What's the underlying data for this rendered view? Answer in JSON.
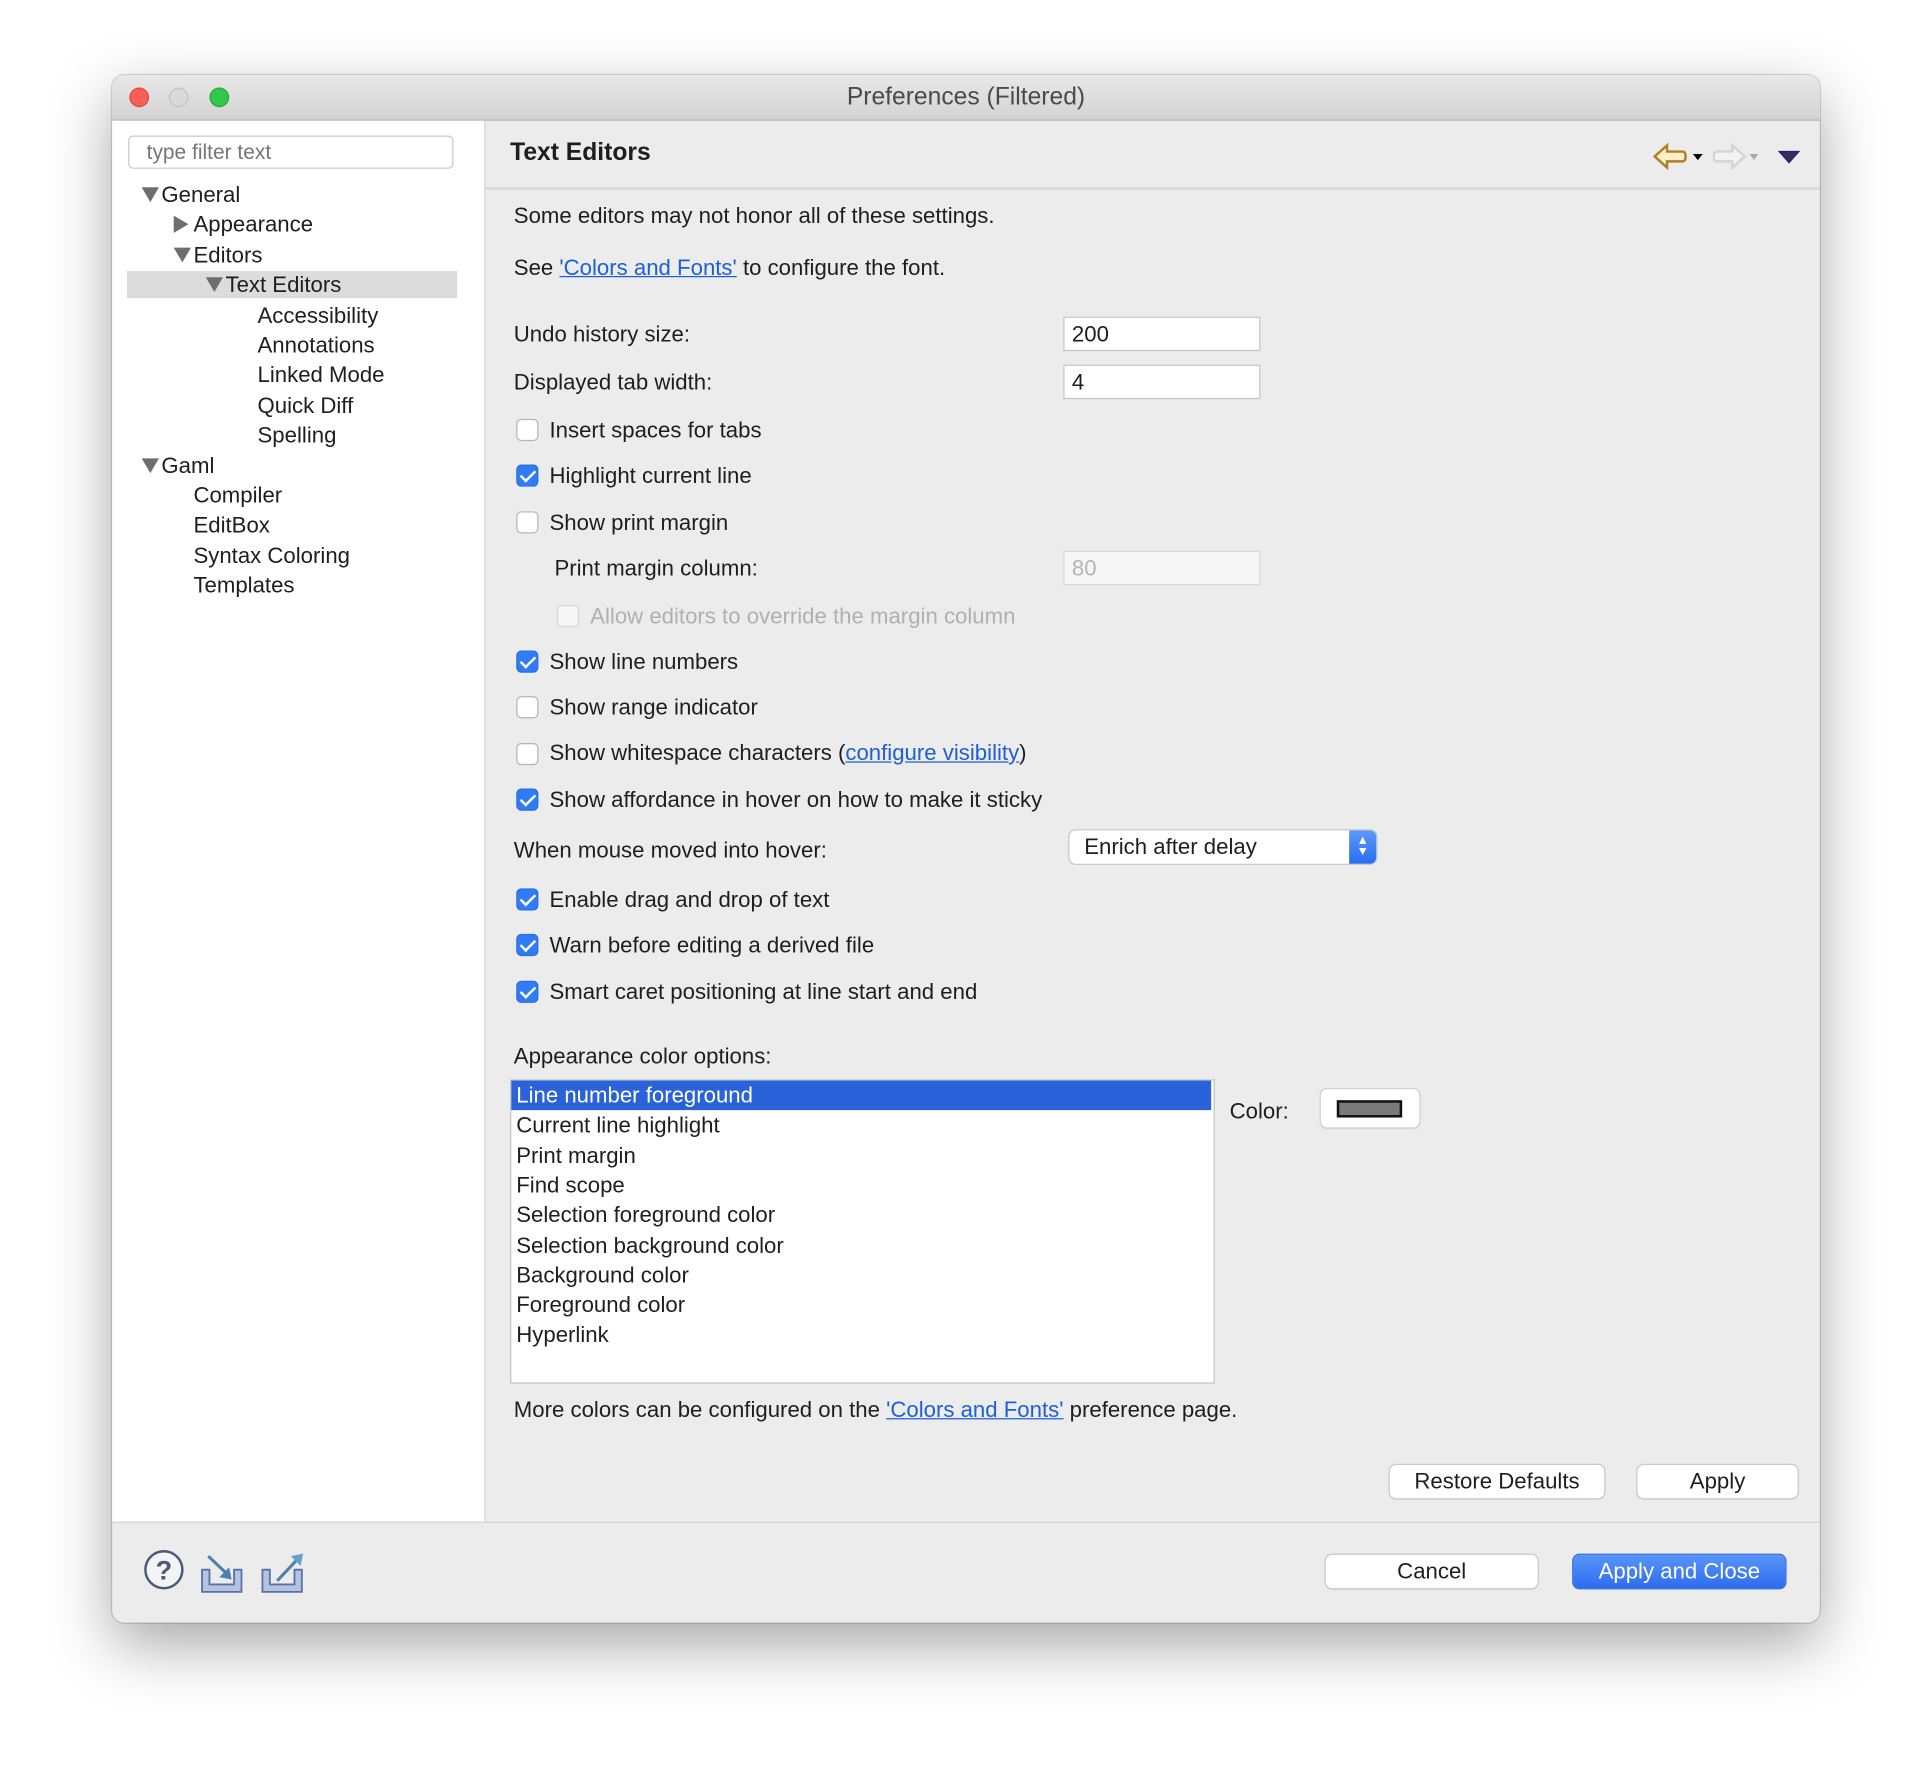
{
  "window": {
    "title": "Preferences (Filtered)"
  },
  "sidebar": {
    "filter_placeholder": "type filter text",
    "items": [
      {
        "label": "General",
        "level": 0,
        "expander": "expanded"
      },
      {
        "label": "Appearance",
        "level": 1,
        "expander": "collapsed"
      },
      {
        "label": "Editors",
        "level": 1,
        "expander": "expanded"
      },
      {
        "label": "Text Editors",
        "level": 2,
        "expander": "expanded",
        "selected": true
      },
      {
        "label": "Accessibility",
        "level": 3
      },
      {
        "label": "Annotations",
        "level": 3
      },
      {
        "label": "Linked Mode",
        "level": 3
      },
      {
        "label": "Quick Diff",
        "level": 3
      },
      {
        "label": "Spelling",
        "level": 3
      },
      {
        "label": "Gaml",
        "level": 0,
        "expander": "expanded"
      },
      {
        "label": "Compiler",
        "level": 1
      },
      {
        "label": "EditBox",
        "level": 1
      },
      {
        "label": "Syntax Coloring",
        "level": 1
      },
      {
        "label": "Templates",
        "level": 1
      }
    ]
  },
  "page": {
    "title": "Text Editors",
    "intro": "Some editors may not honor all of these settings.",
    "see_prefix": "See ",
    "see_link": "'Colors and Fonts'",
    "see_suffix": " to configure the font.",
    "undo_label": "Undo history size:",
    "undo_value": "200",
    "tab_label": "Displayed tab width:",
    "tab_value": "4",
    "checkboxes": [
      {
        "label": "Insert spaces for tabs",
        "checked": false
      },
      {
        "label": "Highlight current line",
        "checked": true
      },
      {
        "label": "Show print margin",
        "checked": false
      }
    ],
    "margin_label": "Print margin column:",
    "margin_value": "80",
    "override_label": "Allow editors to override the margin column",
    "override_checked": false,
    "checkboxes2": [
      {
        "label": "Show line numbers",
        "checked": true
      },
      {
        "label": "Show range indicator",
        "checked": false
      }
    ],
    "whitespace_label": "Show whitespace characters",
    "whitespace_open": " (",
    "whitespace_link": "configure visibility",
    "whitespace_close": ")",
    "whitespace_checked": false,
    "affordance_label": "Show affordance in hover on how to make it sticky",
    "affordance_checked": true,
    "hover_label": "When mouse moved into hover:",
    "hover_value": "Enrich after delay",
    "checkboxes3": [
      {
        "label": "Enable drag and drop of text",
        "checked": true
      },
      {
        "label": "Warn before editing a derived file",
        "checked": true
      },
      {
        "label": "Smart caret positioning at line start and end",
        "checked": true
      }
    ],
    "color_options_label": "Appearance color options:",
    "color_options": [
      "Line number foreground",
      "Current line highlight",
      "Print margin",
      "Find scope",
      "Selection foreground color",
      "Selection background color",
      "Background color",
      "Foreground color",
      "Hyperlink"
    ],
    "color_label": "Color:",
    "color_value": "#7a7a7a",
    "more_prefix": "More colors can be configured on the ",
    "more_link": "'Colors and Fonts'",
    "more_suffix": " preference page.",
    "restore_defaults": "Restore Defaults",
    "apply": "Apply"
  },
  "footer": {
    "cancel": "Cancel",
    "apply_close": "Apply and Close"
  },
  "colors": {
    "accent": "#2f7cf6",
    "selection": "#2a62d9",
    "link": "#1d5fd6"
  }
}
